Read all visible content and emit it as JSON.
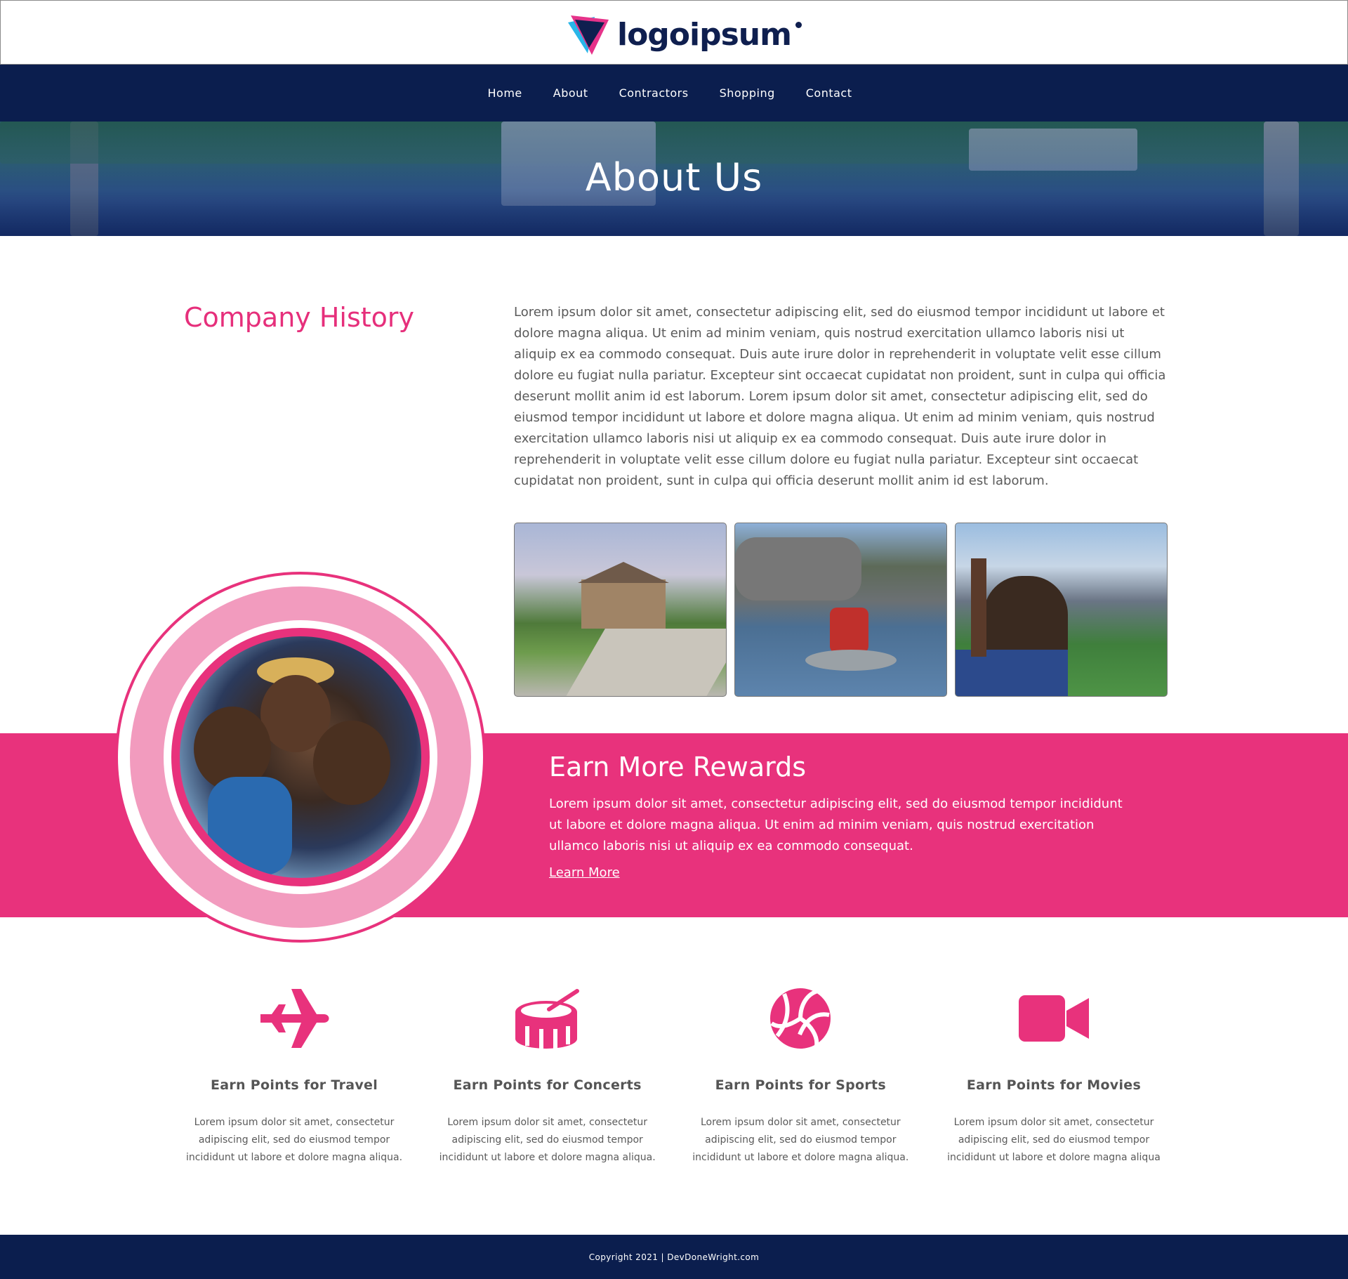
{
  "brand": {
    "logo_text": "logoipsum",
    "colors": {
      "navy": "#0b1e4e",
      "pink": "#e8327c",
      "light_pink": "#f29bbe",
      "logo_cyan": "#29b6e8",
      "logo_magenta": "#e6338a"
    }
  },
  "nav": {
    "items": [
      {
        "label": "Home"
      },
      {
        "label": "About"
      },
      {
        "label": "Contractors"
      },
      {
        "label": "Shopping"
      },
      {
        "label": "Contact"
      }
    ]
  },
  "hero": {
    "title": "About Us"
  },
  "history": {
    "title": "Company History",
    "text": "Lorem ipsum dolor sit amet, consectetur adipiscing elit, sed do eiusmod tempor incididunt ut labore et dolore magna aliqua. Ut enim ad minim veniam, quis nostrud exercitation ullamco laboris nisi ut aliquip ex ea commodo consequat. Duis aute irure dolor in reprehenderit in voluptate velit esse cillum dolore eu fugiat nulla pariatur. Excepteur sint occaecat cupidatat non proident, sunt in culpa qui officia deserunt mollit anim id est laborum. Lorem ipsum dolor sit amet, consectetur adipiscing elit, sed do eiusmod tempor incididunt ut labore et dolore magna aliqua. Ut enim ad minim veniam, quis nostrud exercitation ullamco laboris nisi ut aliquip ex ea commodo consequat. Duis aute irure dolor in reprehenderit in voluptate velit esse cillum dolore eu fugiat nulla pariatur. Excepteur sint occaecat cupidatat non proident, sunt in culpa qui officia deserunt mollit anim id est laborum."
  },
  "rewards": {
    "title": "Earn More Rewards",
    "text": "Lorem ipsum dolor sit amet, consectetur adipiscing elit, sed do eiusmod tempor incididunt ut labore et dolore magna aliqua. Ut enim ad minim veniam, quis nostrud exercitation ullamco laboris nisi ut aliquip ex ea commodo consequat.",
    "link": "Learn More"
  },
  "features": [
    {
      "icon": "airplane-icon",
      "title": "Earn Points for Travel",
      "text": "Lorem ipsum dolor sit amet, consectetur adipiscing elit, sed do eiusmod tempor incididunt ut labore et dolore magna aliqua."
    },
    {
      "icon": "drum-icon",
      "title": "Earn Points for Concerts",
      "text": "Lorem ipsum dolor sit amet, consectetur adipiscing elit, sed do eiusmod tempor incididunt ut labore et dolore magna aliqua."
    },
    {
      "icon": "volleyball-icon",
      "title": "Earn Points for Sports",
      "text": "Lorem ipsum dolor sit amet, consectetur adipiscing elit, sed do eiusmod tempor incididunt ut labore et dolore magna aliqua."
    },
    {
      "icon": "video-camera-icon",
      "title": "Earn Points for Movies",
      "text": "Lorem ipsum dolor sit amet, consectetur adipiscing elit, sed do eiusmod tempor incididunt ut labore et dolore magna aliqua"
    }
  ],
  "footer": {
    "copyright": "Copyright 2021 | DevDoneWright.com"
  }
}
